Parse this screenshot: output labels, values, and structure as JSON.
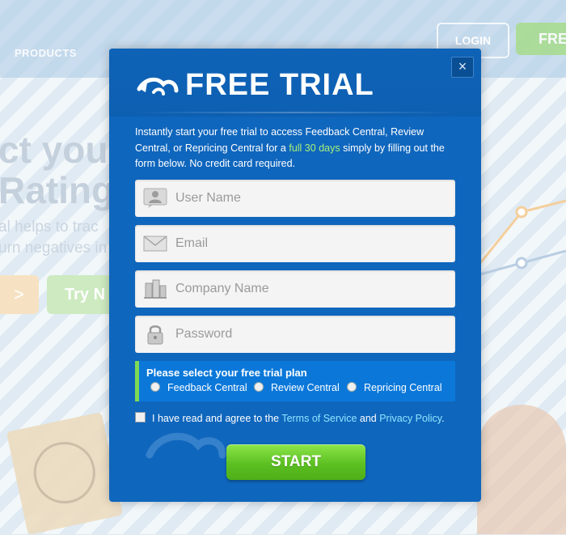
{
  "background": {
    "nav_products": "PRODUCTS",
    "login_label": "LOGIN",
    "free_label": "FRE",
    "headline_line1": "ct you",
    "headline_line2": "Rating",
    "sub_line1": "al helps to trac",
    "sub_line2": "urn negatives in",
    "try_label": "Try N",
    "arrow_label": ">"
  },
  "modal": {
    "title": "FREE TRIAL",
    "close_label": "×",
    "intro_before": "Instantly start your free trial to access Feedback Central, Review Central, or Repricing Central for a ",
    "intro_highlight": "full 30 days",
    "intro_after": " simply by filling out the form below. No credit card required.",
    "fields": {
      "username_placeholder": "User Name",
      "email_placeholder": "Email",
      "company_placeholder": "Company Name",
      "password_placeholder": "Password"
    },
    "plan": {
      "title": "Please select your free trial plan",
      "options": [
        "Feedback Central",
        "Review Central",
        "Repricing Central"
      ]
    },
    "agree": {
      "before": "I have read and agree to the ",
      "terms": "Terms of Service",
      "and": " and ",
      "privacy": "Privacy Policy",
      "after": "."
    },
    "start_label": "START"
  },
  "colors": {
    "modal_bg": "#0f66bd",
    "highlight": "#a8f07a",
    "link": "#8fe6ff",
    "start_green": "#5cc022"
  }
}
